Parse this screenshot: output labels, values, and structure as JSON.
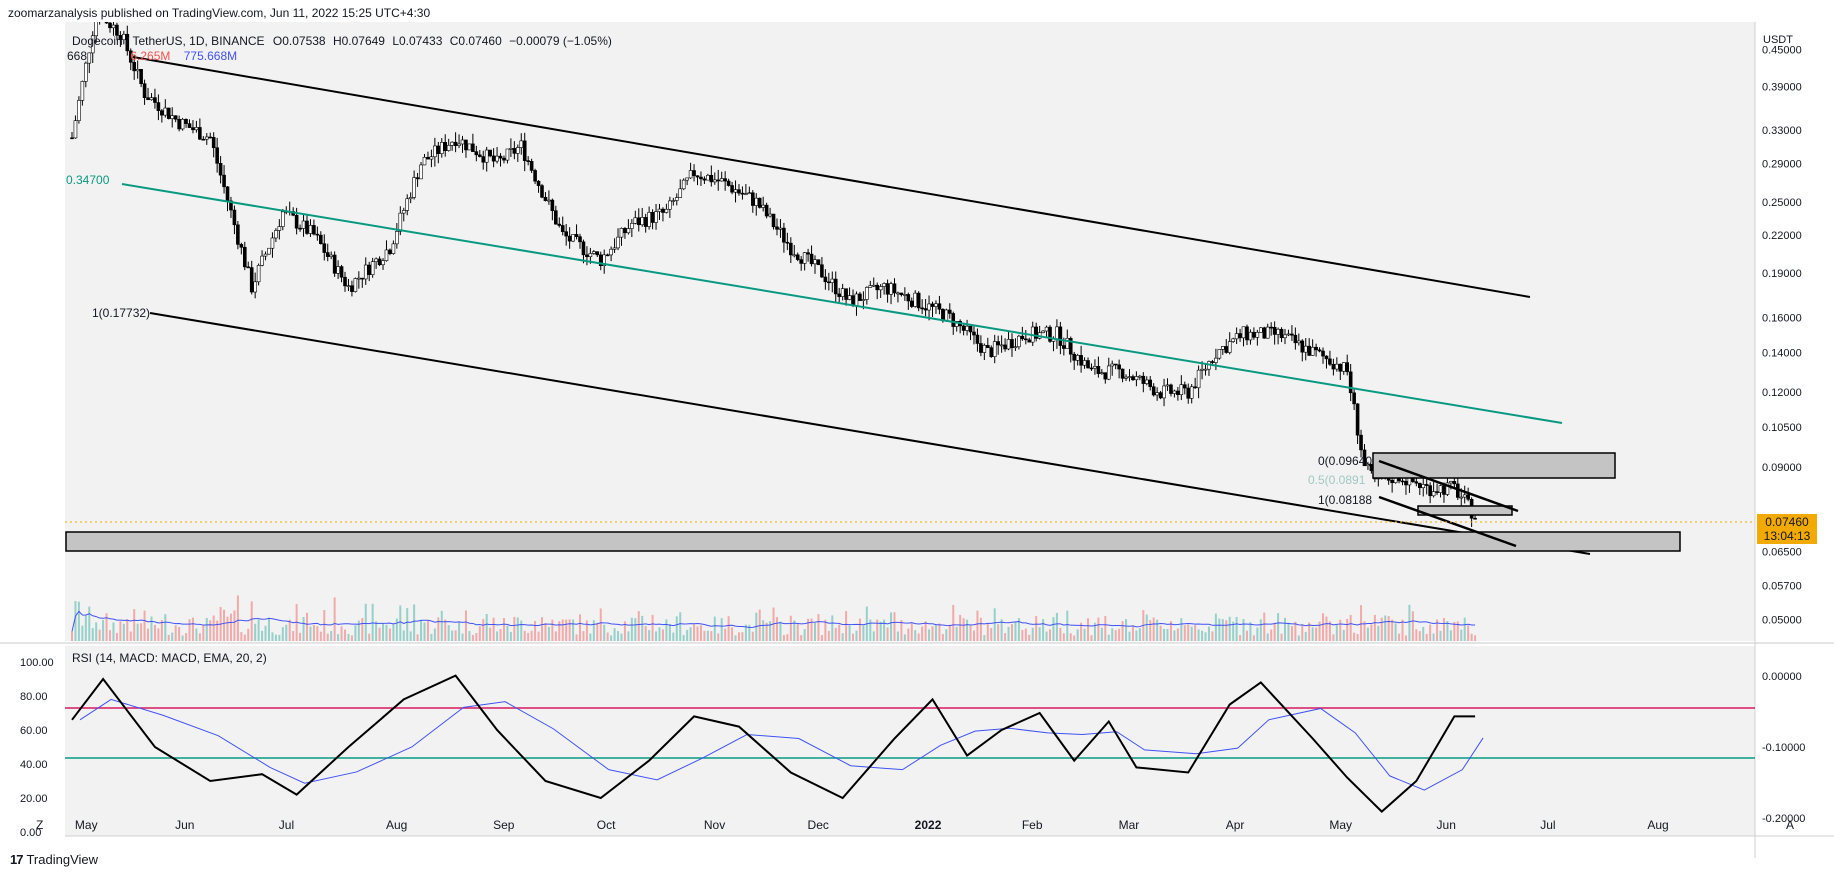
{
  "header": {
    "published": "zoomarzanalysis published on TradingView.com, Jun 11, 2022 15:25 UTC+4:30"
  },
  "legend": {
    "symbol": "Dogecoin / TetherUS, 1D, BINANCE",
    "open": "O0.07538",
    "high": "H0.07649",
    "low": "L0.07433",
    "close": "C0.07460",
    "change": "−0.00079 (−1.05%)",
    "volume_prefix": "668",
    "volume_red": "6.265M",
    "volume_blue": "775.668M"
  },
  "price_axis": {
    "unit": "USDT",
    "ticks": [
      "0.45000",
      "0.39000",
      "0.33000",
      "0.29000",
      "0.25000",
      "0.22000",
      "0.19000",
      "0.16000",
      "0.14000",
      "0.12000",
      "0.10500",
      "0.09000",
      "0.07460",
      "0.06500",
      "0.05700",
      "0.05000"
    ]
  },
  "last_price": {
    "value": "0.07460",
    "countdown": "13:04:13"
  },
  "fib_labels": {
    "channel_top": "0.34700",
    "channel_bottom": "1(0.17732)",
    "flag_0": "0(0.09640",
    "flag_05": "0.5(0.0891",
    "flag_1": "1(0.08188"
  },
  "indicator": {
    "label": "RSI (14, MACD: MACD, EMA, 20, 2)",
    "left_ticks": [
      "100.00",
      "80.00",
      "60.00",
      "40.00",
      "20.00",
      "0.00"
    ],
    "right_ticks": [
      "0.00000",
      "-0.10000",
      "-0.20000"
    ]
  },
  "time_axis": {
    "labels": [
      "May",
      "Jun",
      "Jul",
      "Aug",
      "Sep",
      "Oct",
      "Nov",
      "Dec",
      "2022",
      "Feb",
      "Mar",
      "Apr",
      "May",
      "Jun",
      "Jul",
      "Aug"
    ],
    "left_button": "Z",
    "right_button": "A"
  },
  "footer": {
    "brand": "TradingView"
  },
  "colors": {
    "up": "#26a69a",
    "down": "#ef5350",
    "channel_mid": "#089981",
    "rsi_upper": "#d81b60",
    "rsi_lower": "#089981",
    "signal": "#3f51f5",
    "badge": "#f2a900"
  },
  "chart_data": {
    "type": "line",
    "title": "Dogecoin / TetherUS, 1D, BINANCE",
    "ylabel": "USDT",
    "y_scale": "log",
    "ylim": [
      0.046,
      0.5
    ],
    "x_range": [
      "2021-05-01",
      "2022-08-31"
    ],
    "series": [
      {
        "name": "",
        "x": [
          "2021-05-01",
          "2021-05-08",
          "2021-05-15",
          "2021-05-22",
          "2021-06-01",
          "2021-06-10",
          "2021-06-22",
          "2021-07-01",
          "2021-07-10",
          "2021-07-20",
          "2021-08-01",
          "2021-08-10",
          "2021-08-20",
          "2021-09-01",
          "2021-09-08",
          "2021-09-20",
          "2021-10-01",
          "2021-10-10",
          "2021-10-20",
          "2021-10-28",
          "2021-11-05",
          "2021-11-15",
          "2021-11-25",
          "2021-12-04",
          "2021-12-12",
          "2021-12-22",
          "2022-01-01",
          "2022-01-10",
          "2022-01-21",
          "2022-02-01",
          "2022-02-10",
          "2022-02-20",
          "2022-03-01",
          "2022-03-12",
          "2022-03-20",
          "2022-03-28",
          "2022-04-05",
          "2022-04-15",
          "2022-04-25",
          "2022-05-01",
          "2022-05-05",
          "2022-05-10",
          "2022-05-13",
          "2022-05-20",
          "2022-05-28",
          "2022-06-05",
          "2022-06-11"
        ],
        "values": [
          0.32,
          0.52,
          0.48,
          0.38,
          0.34,
          0.32,
          0.18,
          0.24,
          0.22,
          0.18,
          0.21,
          0.29,
          0.32,
          0.29,
          0.31,
          0.22,
          0.2,
          0.23,
          0.24,
          0.28,
          0.27,
          0.25,
          0.21,
          0.19,
          0.17,
          0.18,
          0.17,
          0.16,
          0.14,
          0.15,
          0.15,
          0.13,
          0.13,
          0.12,
          0.12,
          0.14,
          0.15,
          0.15,
          0.14,
          0.135,
          0.13,
          0.09,
          0.085,
          0.087,
          0.083,
          0.083,
          0.0746
        ]
      }
    ],
    "rsi": {
      "x": [
        "2021-05-01",
        "2021-05-10",
        "2021-05-25",
        "2021-06-10",
        "2021-06-25",
        "2021-07-05",
        "2021-07-20",
        "2021-08-05",
        "2021-08-20",
        "2021-09-01",
        "2021-09-15",
        "2021-10-01",
        "2021-10-15",
        "2021-10-28",
        "2021-11-10",
        "2021-11-25",
        "2021-12-10",
        "2021-12-25",
        "2022-01-05",
        "2022-01-15",
        "2022-01-25",
        "2022-02-05",
        "2022-02-15",
        "2022-02-25",
        "2022-03-05",
        "2022-03-20",
        "2022-04-01",
        "2022-04-10",
        "2022-04-25",
        "2022-05-05",
        "2022-05-15",
        "2022-05-25",
        "2022-06-05",
        "2022-06-11"
      ],
      "values": [
        66,
        90,
        50,
        30,
        34,
        22,
        50,
        78,
        92,
        60,
        30,
        20,
        42,
        68,
        62,
        35,
        20,
        55,
        78,
        45,
        60,
        70,
        42,
        65,
        38,
        35,
        75,
        88,
        55,
        32,
        12,
        30,
        68,
        68
      ]
    },
    "rsi_levels": [
      70,
      30
    ]
  }
}
